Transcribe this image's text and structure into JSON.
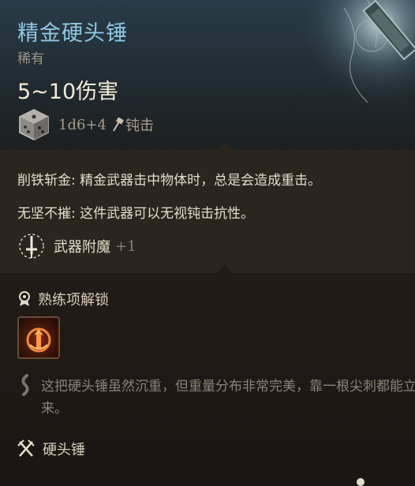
{
  "item": {
    "name": "精金硬头锤",
    "rarity": "稀有",
    "damage": "5~10伤害",
    "dice": "1d6+4",
    "damage_type": "钝击"
  },
  "properties": [
    {
      "name": "削铁斩金:",
      "text": " 精金武器击中物体时，总是会造成重击。"
    },
    {
      "name": "无坚不摧:",
      "text": " 这件武器可以无视钝击抗性。"
    }
  ],
  "enchantment": {
    "label": "武器附魔",
    "value": "+1"
  },
  "proficiency": {
    "label": "熟练项解锁"
  },
  "flavor": "这把硬头锤虽然沉重，但重量分布非常完美，靠一根尖刺都能立起来。",
  "weapon_type": "硬头锤",
  "icons": {
    "dice": "d6-dice-icon",
    "damage_type": "bludgeon-icon",
    "enchant": "enchant-sword-icon",
    "proficiency": "proficiency-medal-icon",
    "skill": "weapon-action-icon",
    "flavor": "quote-icon",
    "weapon_type": "crossed-weapons-icon"
  },
  "colors": {
    "title": "#8fc8e3",
    "header_bg": "#233139",
    "panel_bg": "#2b2520"
  }
}
